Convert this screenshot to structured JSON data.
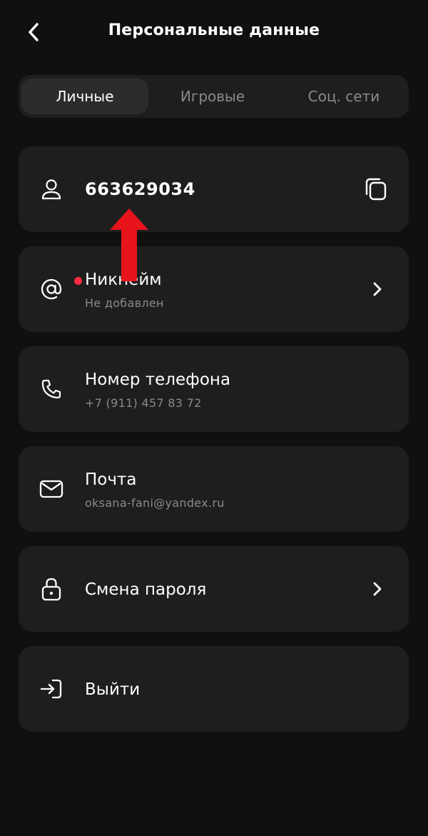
{
  "header": {
    "title": "Персональные данные",
    "back_icon": "chevron-left-icon"
  },
  "tabs": [
    {
      "label": "Личные",
      "active": true
    },
    {
      "label": "Игровые",
      "active": false
    },
    {
      "label": "Соц. сети",
      "active": false
    }
  ],
  "profile": {
    "user_id": "663629034",
    "user_icon": "user-icon",
    "copy_icon": "copy-icon"
  },
  "items": [
    {
      "label": "Никнейм",
      "value": "Не добавлен",
      "icon": "at-sign-icon",
      "has_badge": true,
      "chevron": true
    },
    {
      "label": "Номер телефона",
      "value": "+7 (911) 457 83 72",
      "icon": "phone-icon",
      "chevron": false
    },
    {
      "label": "Почта",
      "value": "oksana-fani@yandex.ru",
      "icon": "mail-icon",
      "chevron": false
    },
    {
      "label": "Смена пароля",
      "value": "",
      "icon": "lock-icon",
      "chevron": true
    },
    {
      "label": "Выйти",
      "value": "",
      "icon": "logout-icon",
      "chevron": false
    }
  ],
  "annotation": {
    "arrow_color": "#e8141c",
    "arrow_direction": "up"
  },
  "colors": {
    "background": "#101010",
    "card": "#1e1e1e",
    "active_tab": "#2c2c2c",
    "muted_text": "#8a8a8a",
    "badge": "#ff2d3f"
  }
}
